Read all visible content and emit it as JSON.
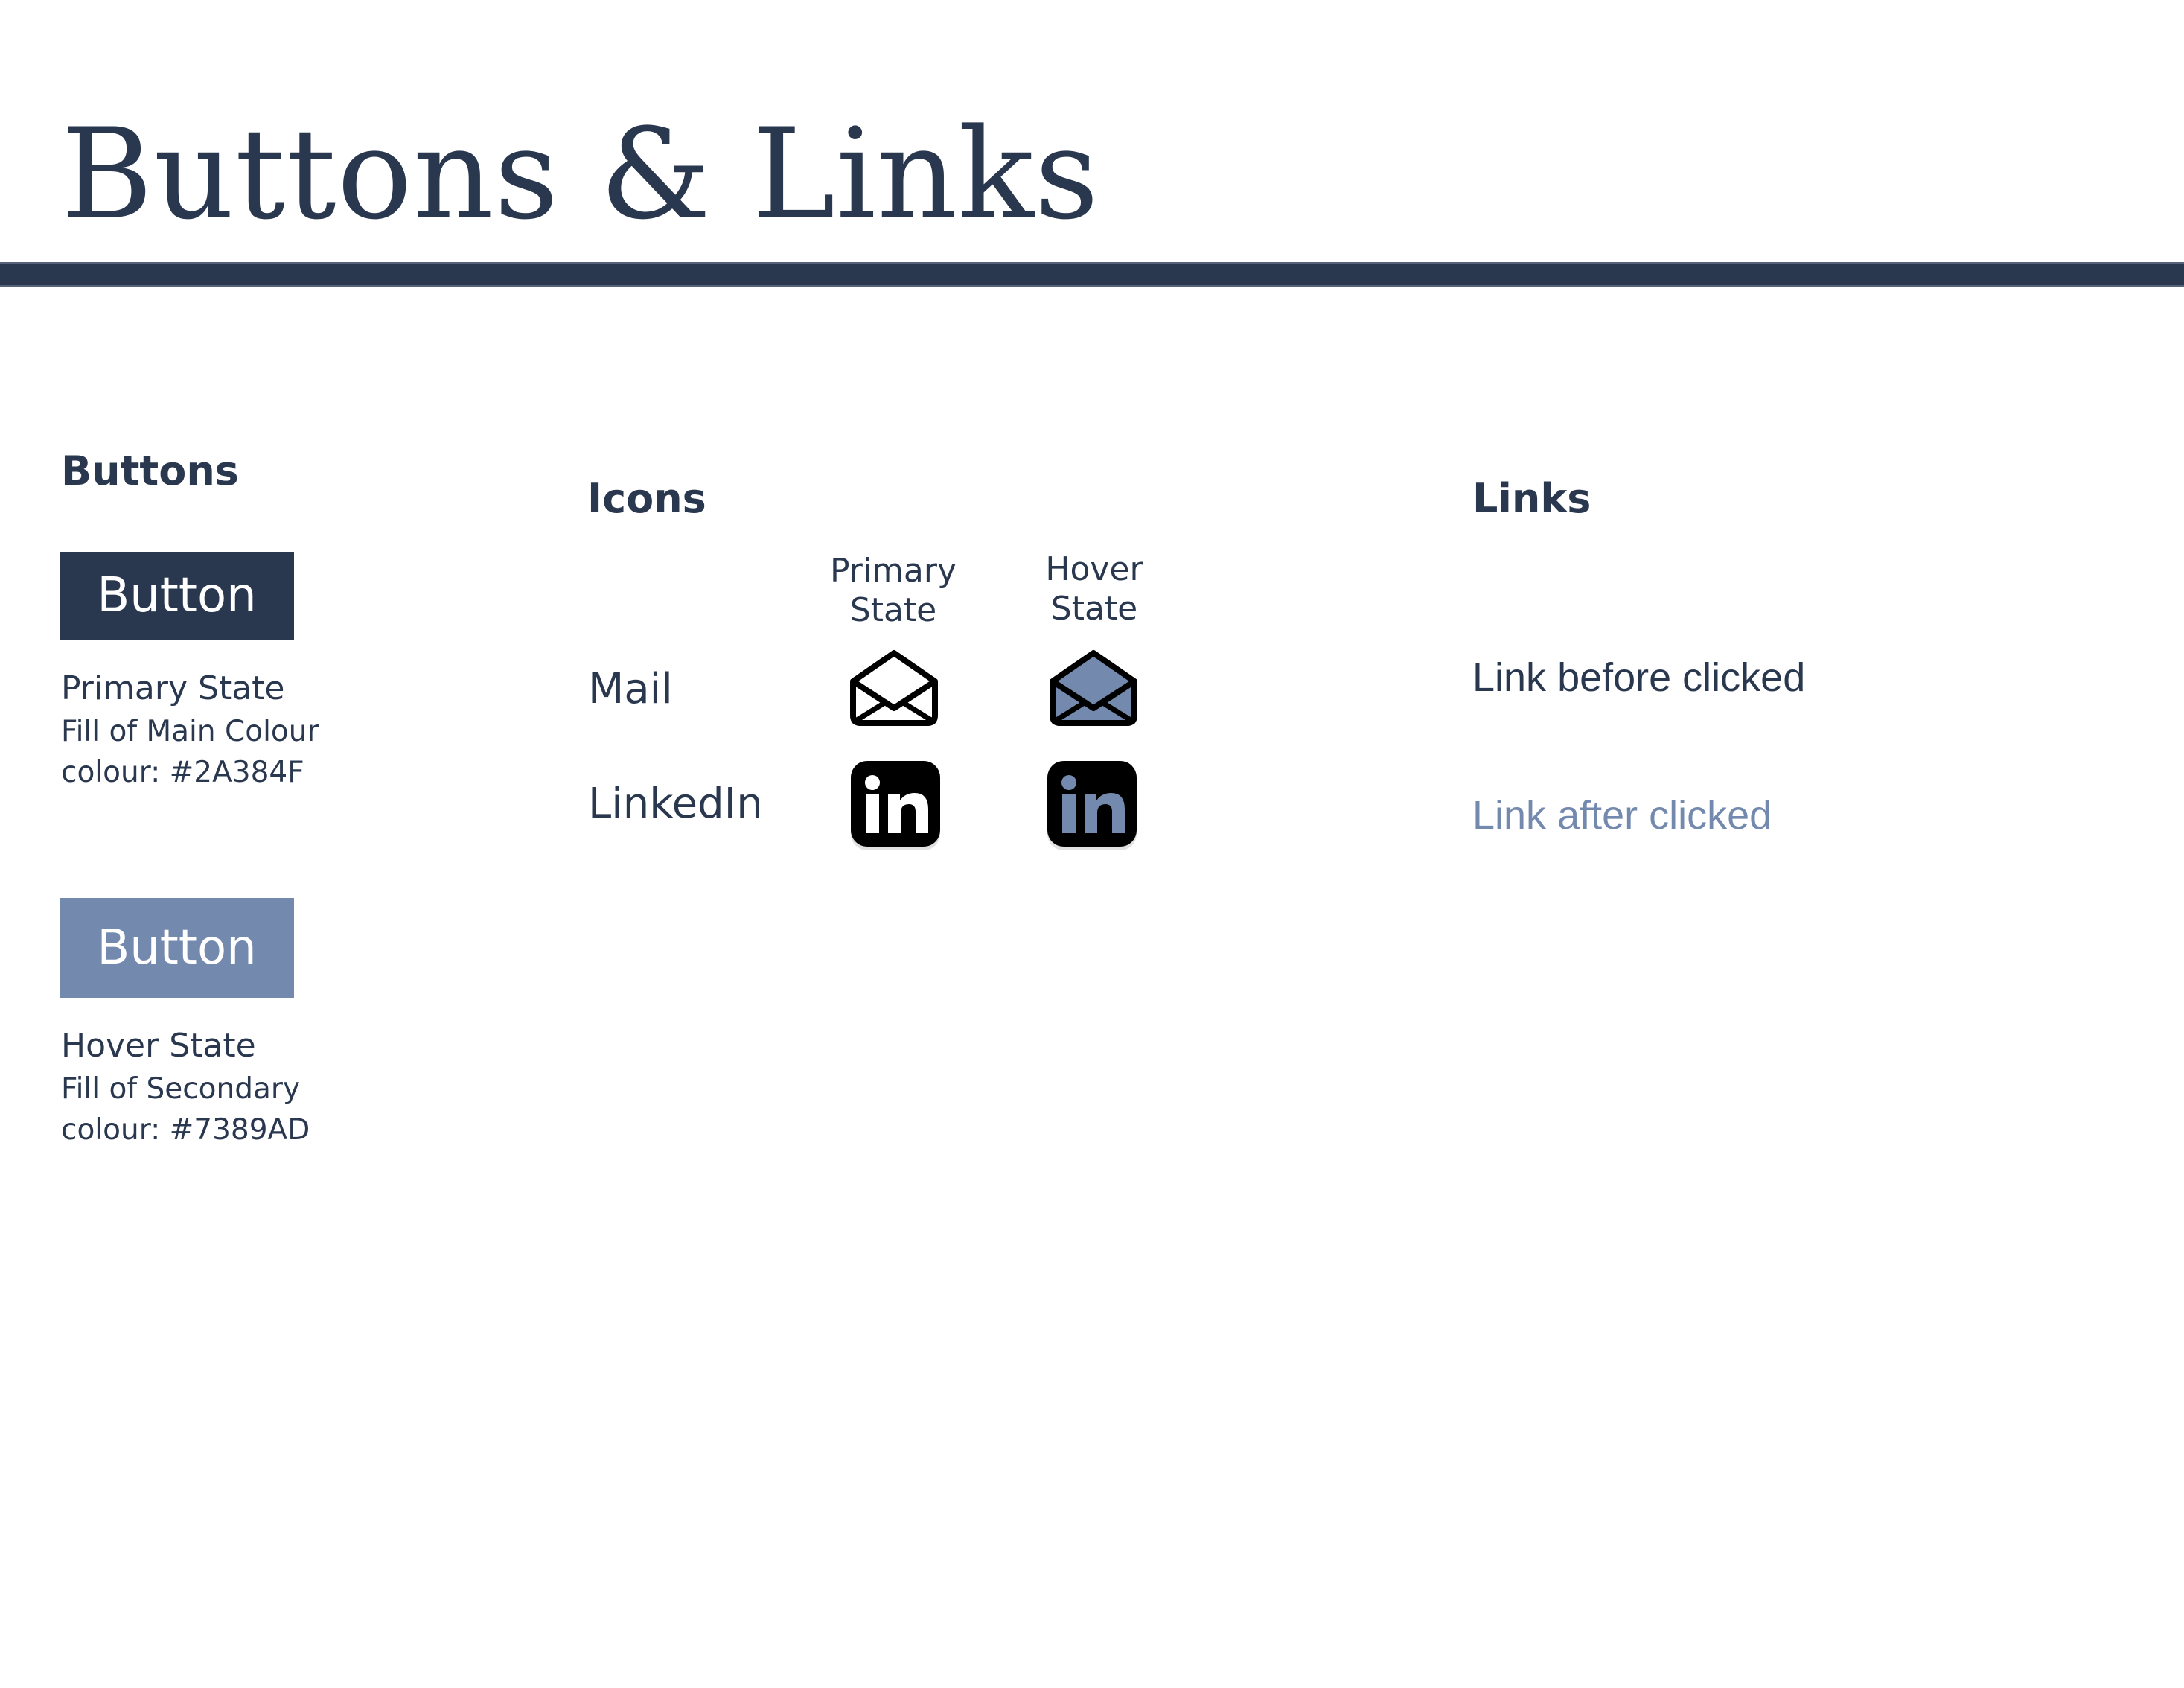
{
  "page": {
    "title": "Buttons & Links"
  },
  "colors": {
    "main": "#2A384F",
    "secondary": "#7389AD",
    "icon_black": "#000000",
    "background": "#FFFFFF"
  },
  "buttons_section": {
    "heading": "Buttons",
    "primary": {
      "label": "Button",
      "state": "Primary State",
      "desc_line1": "Fill of Main Colour",
      "desc_line2": "colour: #2A384F"
    },
    "hover": {
      "label": "Button",
      "state": "Hover State",
      "desc_line1": "Fill of Secondary",
      "desc_line2": "colour: #7389AD"
    }
  },
  "icons_section": {
    "heading": "Icons",
    "columns": [
      {
        "line1": "Primary",
        "line2": "State"
      },
      {
        "line1": "Hover",
        "line2": "State"
      }
    ],
    "rows": [
      {
        "label": "Mail",
        "icon": "mail-icon"
      },
      {
        "label": "LinkedIn",
        "icon": "linkedin-icon"
      }
    ]
  },
  "links_section": {
    "heading": "Links",
    "before": "Link before clicked",
    "after": "Link after clicked"
  }
}
